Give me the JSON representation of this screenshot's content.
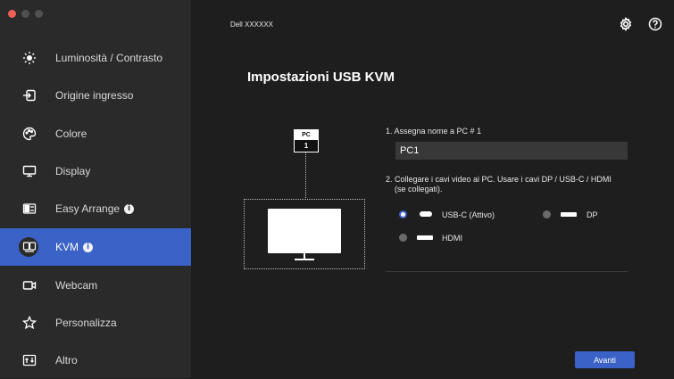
{
  "window": {
    "title": "Dell XXXXXX"
  },
  "colors": {
    "accent": "#3a62c7",
    "sidebar_bg": "#2a2a2a",
    "main_bg": "#1e1e1e"
  },
  "sidebar": {
    "items": [
      {
        "label": "Luminosità / Contrasto",
        "icon": "brightness-icon"
      },
      {
        "label": "Origine ingresso",
        "icon": "input-source-icon"
      },
      {
        "label": "Colore",
        "icon": "color-palette-icon"
      },
      {
        "label": "Display",
        "icon": "display-icon"
      },
      {
        "label": "Easy Arrange",
        "icon": "easy-arrange-icon",
        "info": "i"
      },
      {
        "label": "KVM",
        "icon": "kvm-icon",
        "info": "i",
        "active": true
      },
      {
        "label": "Webcam",
        "icon": "webcam-icon"
      },
      {
        "label": "Personalizza",
        "icon": "star-icon"
      },
      {
        "label": "Altro",
        "icon": "other-icon"
      }
    ]
  },
  "header": {
    "settings_icon": "gear-icon",
    "help_icon": "help-icon"
  },
  "main": {
    "title": "Impostazioni USB KVM",
    "diagram": {
      "pc_label": "PC",
      "pc_number": "1"
    },
    "step1": {
      "label": "1. Assegna nome a PC # 1",
      "value": "PC1"
    },
    "step2": {
      "label_line1": "2. Collegare i cavi video ai PC. Usare i cavi DP / USB-C / HDMI",
      "label_line2": "(se collegati).",
      "options": [
        {
          "label": "USB-C (Attivo)",
          "selected": true
        },
        {
          "label": "DP",
          "selected": false
        },
        {
          "label": "HDMI",
          "selected": false
        }
      ]
    },
    "next_button": "Avanti"
  }
}
